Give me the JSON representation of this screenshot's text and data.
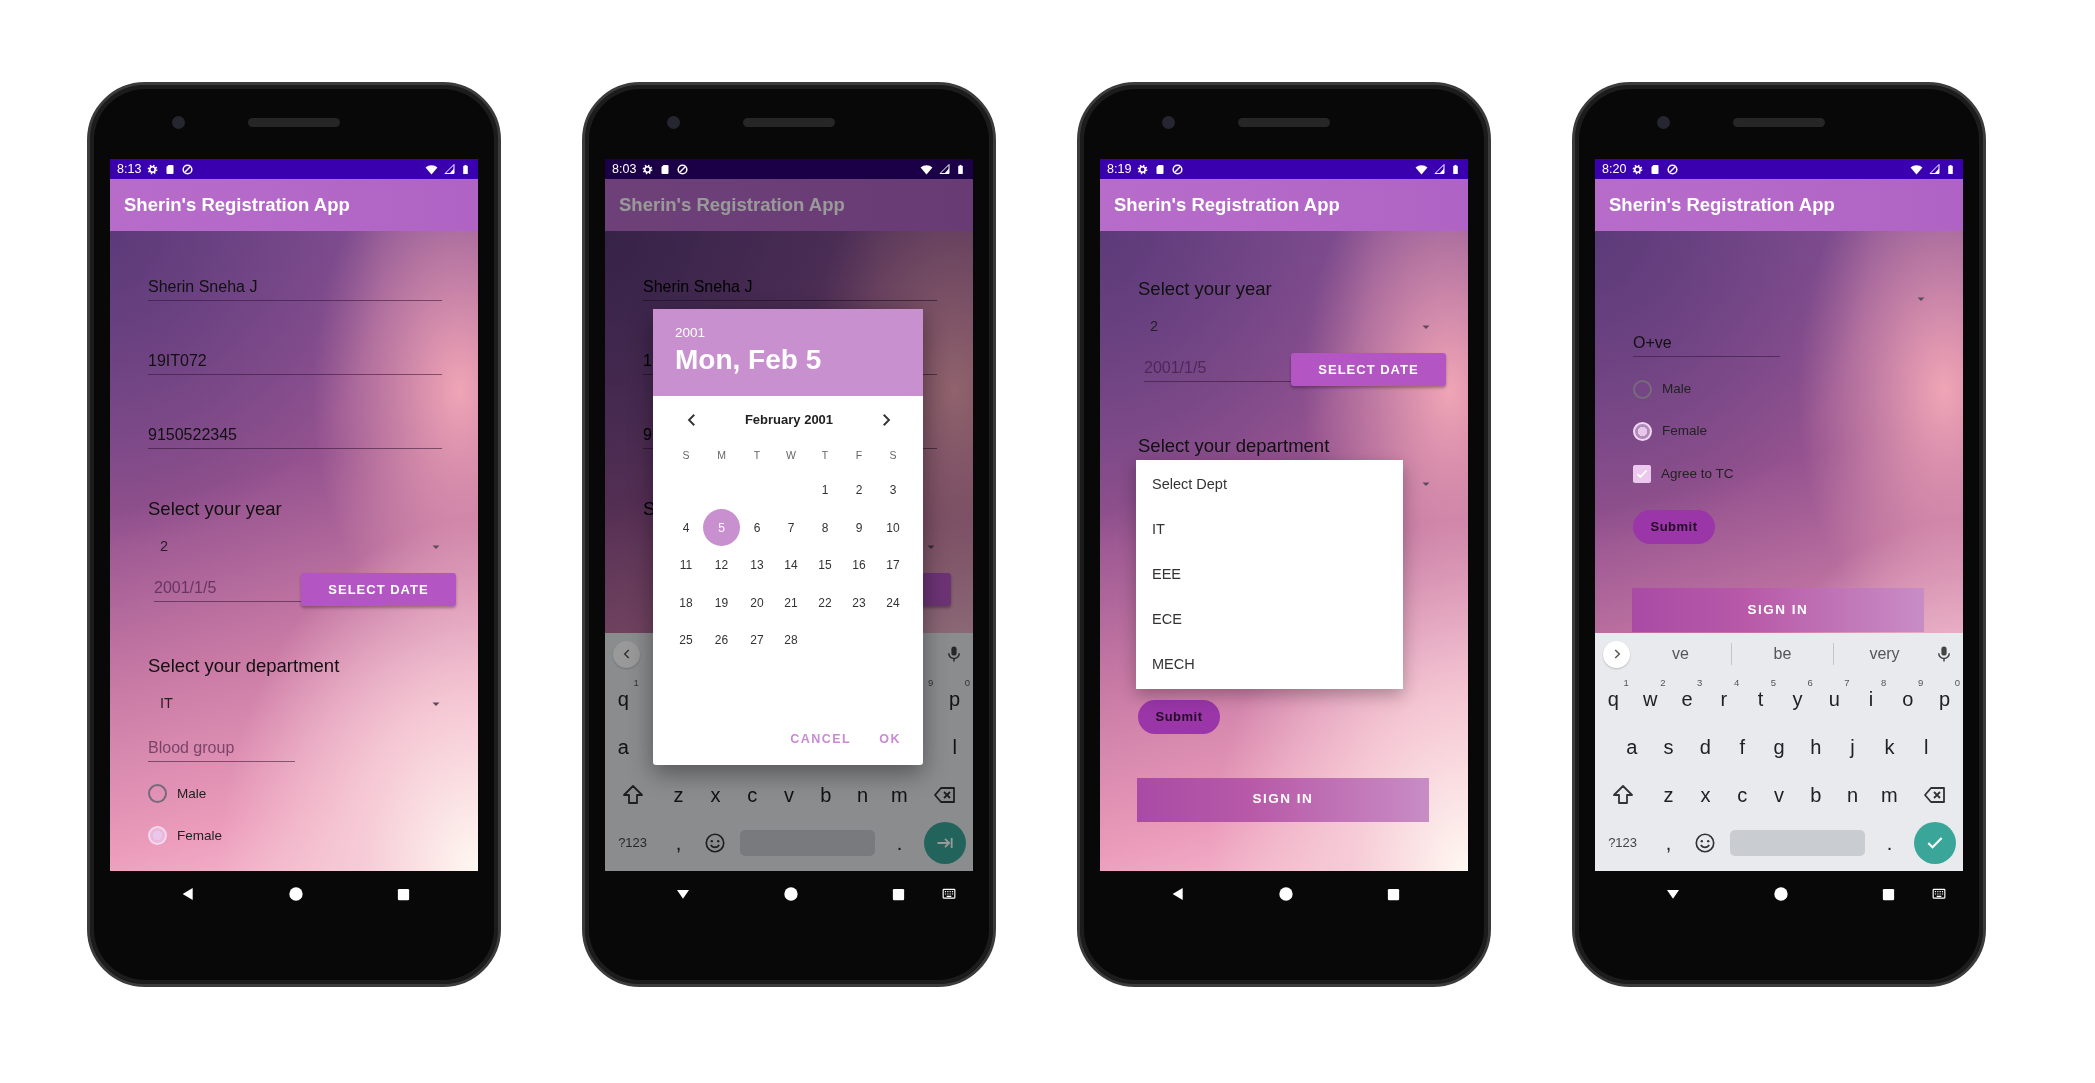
{
  "phones": [
    {
      "status": {
        "time": "8:13"
      },
      "app_bar": {
        "title": "Sherin's Registration App"
      },
      "dimmed": false,
      "form": [
        {
          "kind": "text_field",
          "value": "Sherin Sneha J"
        },
        {
          "kind": "text_field",
          "value": "19IT072"
        },
        {
          "kind": "text_field",
          "value": "9150522345"
        },
        {
          "kind": "label",
          "text": "Select your year"
        },
        {
          "kind": "spinner",
          "value": "2"
        },
        {
          "kind": "date_row",
          "placeholder": "2001/1/5",
          "button": "SELECT DATE"
        },
        {
          "kind": "label",
          "text": "Select your department"
        },
        {
          "kind": "spinner",
          "value": "IT"
        },
        {
          "kind": "short_field",
          "placeholder": "Blood group"
        },
        {
          "kind": "radio",
          "label": "Male",
          "selected": false
        },
        {
          "kind": "radio",
          "label": "Female",
          "selected": true
        }
      ]
    },
    {
      "status": {
        "time": "8:03"
      },
      "app_bar": {
        "title": "Sherin's Registration App"
      },
      "dimmed": true,
      "form": [
        {
          "kind": "text_field",
          "value": "Sherin Sneha J"
        },
        {
          "kind": "text_field",
          "value": "1"
        },
        {
          "kind": "text_field",
          "value": "9"
        },
        {
          "kind": "label",
          "text": "S"
        },
        {
          "kind": "spinner"
        },
        {
          "kind": "date_row"
        }
      ],
      "date_picker": {
        "year": "2001",
        "date": "Mon, Feb 5",
        "month": "February 2001",
        "weekdays": [
          "S",
          "M",
          "T",
          "W",
          "T",
          "F",
          "S"
        ],
        "weeks": [
          {
            "kind": "lead",
            "days": [
              {
                "day": "1",
                "selected": false
              },
              {
                "day": "2",
                "selected": false
              },
              {
                "day": "3",
                "selected": false
              }
            ]
          },
          {
            "kind": "week",
            "days": [
              {
                "day": "4",
                "selected": false
              },
              {
                "day": "5",
                "selected": true
              },
              {
                "day": "6",
                "selected": false
              },
              {
                "day": "7",
                "selected": false
              },
              {
                "day": "8",
                "selected": false
              },
              {
                "day": "9",
                "selected": false
              },
              {
                "day": "10",
                "selected": false
              }
            ]
          },
          {
            "kind": "week",
            "days": [
              {
                "day": "11",
                "selected": false
              },
              {
                "day": "12",
                "selected": false
              },
              {
                "day": "13",
                "selected": false
              },
              {
                "day": "14",
                "selected": false
              },
              {
                "day": "15",
                "selected": false
              },
              {
                "day": "16",
                "selected": false
              },
              {
                "day": "17",
                "selected": false
              }
            ]
          },
          {
            "kind": "week",
            "days": [
              {
                "day": "18",
                "selected": false
              },
              {
                "day": "19",
                "selected": false
              },
              {
                "day": "20",
                "selected": false
              },
              {
                "day": "21",
                "selected": false
              },
              {
                "day": "22",
                "selected": false
              },
              {
                "day": "23",
                "selected": false
              },
              {
                "day": "24",
                "selected": false
              }
            ]
          },
          {
            "kind": "week",
            "days": [
              {
                "day": "25",
                "selected": false
              },
              {
                "day": "26",
                "selected": false
              },
              {
                "day": "27",
                "selected": false
              },
              {
                "day": "28",
                "selected": false
              }
            ]
          }
        ],
        "buttons": [
          "CANCEL",
          "OK"
        ]
      },
      "keyboard": {
        "toolbar_expanded": true,
        "rows": [
          {
            "keys": [
              {
                "kind": "key",
                "label": "q",
                "hint": "1"
              },
              {
                "kind": "gap"
              },
              {
                "kind": "key",
                "hint": "9"
              },
              {
                "kind": "key",
                "label": "p",
                "hint": "0"
              }
            ]
          },
          {
            "keys": [
              {
                "kind": "key",
                "label": "a"
              },
              {
                "kind": "gap"
              },
              {
                "kind": "key",
                "label": "l"
              }
            ]
          },
          {
            "keys": [
              {
                "kind": "shift"
              },
              {
                "kind": "key",
                "label": "z"
              },
              {
                "kind": "key",
                "label": "x"
              },
              {
                "kind": "key",
                "label": "c"
              },
              {
                "kind": "key",
                "label": "v"
              },
              {
                "kind": "key",
                "label": "b"
              },
              {
                "kind": "key",
                "label": "n"
              },
              {
                "kind": "key",
                "label": "m"
              },
              {
                "kind": "backspace"
              }
            ]
          },
          {
            "keys": [
              {
                "kind": "wide",
                "label": "?123"
              },
              {
                "kind": "key",
                "label": ","
              },
              {
                "kind": "emoji"
              },
              {
                "kind": "space"
              },
              {
                "kind": "key",
                "label": "."
              },
              {
                "kind": "enter"
              }
            ]
          }
        ]
      }
    },
    {
      "status": {
        "time": "8:19"
      },
      "app_bar": {
        "title": "Sherin's Registration App"
      },
      "dimmed": false,
      "form": [
        {
          "kind": "label",
          "text": "Select your year"
        },
        {
          "kind": "spinner",
          "value": "2"
        },
        {
          "kind": "date_row",
          "placeholder": "2001/1/5",
          "button": "SELECT DATE"
        },
        {
          "kind": "label",
          "text": "Select your department"
        },
        {
          "kind": "spinner",
          "dropdown": [
            "Select Dept",
            "IT",
            "EEE",
            "ECE",
            "MECH"
          ]
        },
        {
          "kind": "submit",
          "label": "Submit"
        },
        {
          "kind": "sign_in",
          "label": "SIGN IN"
        }
      ]
    },
    {
      "status": {
        "time": "8:20"
      },
      "app_bar": {
        "title": "Sherin's Registration App"
      },
      "dimmed": false,
      "form": [
        {
          "kind": "spinner"
        },
        {
          "kind": "short_field",
          "value": "O+ve"
        },
        {
          "kind": "radio",
          "label": "Male",
          "selected": false
        },
        {
          "kind": "radio",
          "label": "Female",
          "selected": true
        },
        {
          "kind": "checkbox",
          "label": "Agree to TC",
          "checked": true
        },
        {
          "kind": "submit",
          "label": "Submit"
        },
        {
          "kind": "sign_in",
          "label": "SIGN IN"
        }
      ],
      "keyboard": {
        "toolbar_expanded": false,
        "suggestions": [
          "ve",
          "be",
          "very"
        ],
        "rows": [
          {
            "keys": [
              {
                "kind": "key",
                "label": "q",
                "hint": "1"
              },
              {
                "kind": "key",
                "label": "w",
                "hint": "2"
              },
              {
                "kind": "key",
                "label": "e",
                "hint": "3"
              },
              {
                "kind": "key",
                "label": "r",
                "hint": "4"
              },
              {
                "kind": "key",
                "label": "t",
                "hint": "5"
              },
              {
                "kind": "key",
                "label": "y",
                "hint": "6"
              },
              {
                "kind": "key",
                "label": "u",
                "hint": "7"
              },
              {
                "kind": "key",
                "label": "i",
                "hint": "8"
              },
              {
                "kind": "key",
                "label": "o",
                "hint": "9"
              },
              {
                "kind": "key",
                "label": "p",
                "hint": "0"
              }
            ]
          },
          {
            "keys": [
              {
                "kind": "key",
                "label": "a"
              },
              {
                "kind": "key",
                "label": "s"
              },
              {
                "kind": "key",
                "label": "d"
              },
              {
                "kind": "key",
                "label": "f"
              },
              {
                "kind": "key",
                "label": "g"
              },
              {
                "kind": "key",
                "label": "h"
              },
              {
                "kind": "key",
                "label": "j"
              },
              {
                "kind": "key",
                "label": "k"
              },
              {
                "kind": "key",
                "label": "l"
              }
            ]
          },
          {
            "keys": [
              {
                "kind": "shift"
              },
              {
                "kind": "key",
                "label": "z"
              },
              {
                "kind": "key",
                "label": "x"
              },
              {
                "kind": "key",
                "label": "c"
              },
              {
                "kind": "key",
                "label": "v"
              },
              {
                "kind": "key",
                "label": "b"
              },
              {
                "kind": "key",
                "label": "n"
              },
              {
                "kind": "key",
                "label": "m"
              },
              {
                "kind": "backspace"
              }
            ]
          },
          {
            "keys": [
              {
                "kind": "wide",
                "label": "?123"
              },
              {
                "kind": "key",
                "label": ","
              },
              {
                "kind": "emoji"
              },
              {
                "kind": "space"
              },
              {
                "kind": "key",
                "label": "."
              },
              {
                "kind": "done"
              }
            ]
          }
        ]
      }
    }
  ]
}
